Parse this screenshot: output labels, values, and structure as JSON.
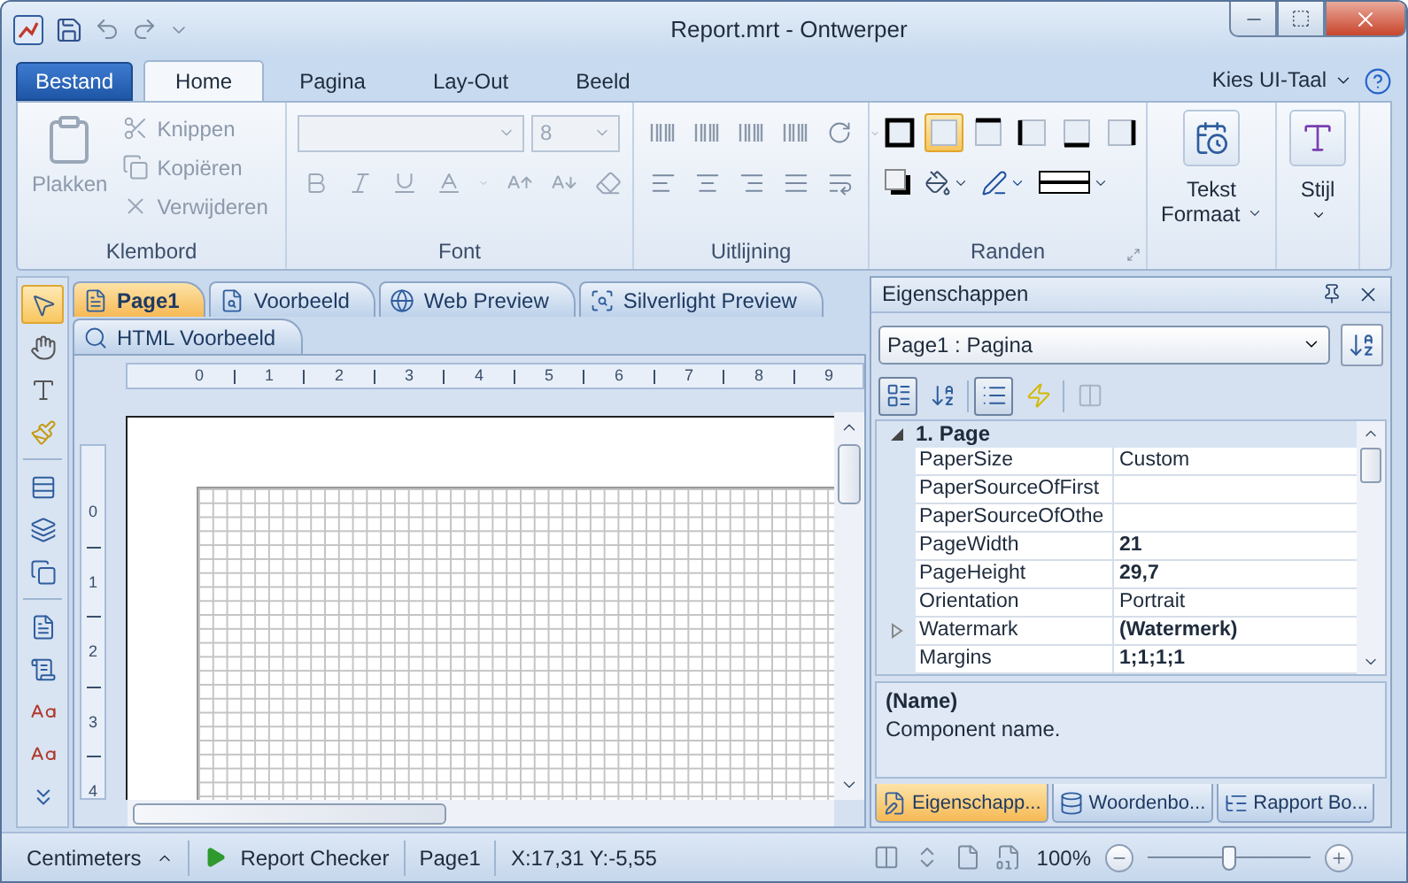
{
  "window": {
    "title": "Report.mrt - Ontwerper"
  },
  "ribbon_tabs": [
    {
      "label": "Bestand",
      "kind": "file",
      "selected": false
    },
    {
      "label": "Home",
      "kind": "tab",
      "selected": true
    },
    {
      "label": "Pagina",
      "kind": "tab",
      "selected": false
    },
    {
      "label": "Lay-Out",
      "kind": "tab",
      "selected": false
    },
    {
      "label": "Beeld",
      "kind": "tab",
      "selected": false
    }
  ],
  "language_menu": {
    "label": "Kies UI-Taal"
  },
  "clipboard": {
    "label": "Klembord",
    "paste": "Plakken",
    "disabled": true,
    "items": [
      {
        "label": "Knippen",
        "kind": "cut"
      },
      {
        "label": "Kopiëren",
        "kind": "copy"
      },
      {
        "label": "Verwijderen",
        "kind": "delete"
      }
    ]
  },
  "font": {
    "label": "Font",
    "size": "8",
    "disabled": true
  },
  "alignment": {
    "label": "Uitlijning"
  },
  "borders": {
    "label": "Randen",
    "buttons": [
      {
        "kind": "all",
        "selected": false
      },
      {
        "kind": "none",
        "selected": true
      },
      {
        "kind": "top",
        "selected": false
      },
      {
        "kind": "left",
        "selected": false
      },
      {
        "kind": "bottom",
        "selected": false
      },
      {
        "kind": "right",
        "selected": false
      }
    ]
  },
  "text_format": {
    "label": "Tekst Formaat"
  },
  "style": {
    "label": "Stijl"
  },
  "tools": [
    {
      "kind": "pointer",
      "selected": true
    },
    {
      "kind": "hand",
      "selected": false
    },
    {
      "kind": "text",
      "selected": false
    },
    {
      "kind": "brush",
      "selected": false
    },
    {
      "kind": "band",
      "selected": false
    },
    {
      "kind": "cross_band",
      "selected": false
    },
    {
      "kind": "container",
      "selected": false
    },
    {
      "kind": "page",
      "selected": false
    },
    {
      "kind": "list",
      "selected": false
    },
    {
      "kind": "text_field",
      "selected": false
    },
    {
      "kind": "rich_text",
      "selected": false
    },
    {
      "kind": "more",
      "selected": false
    }
  ],
  "document_tabs": [
    {
      "label": "Page1",
      "kind": "page",
      "selected": true
    },
    {
      "label": "Voorbeeld",
      "kind": "preview",
      "selected": false
    },
    {
      "label": "Web Preview",
      "kind": "web",
      "selected": false
    },
    {
      "label": "Silverlight Preview",
      "kind": "silverlight",
      "selected": false
    }
  ],
  "document_tabs_second_row": [
    {
      "label": "HTML Voorbeeld",
      "kind": "html",
      "selected": false
    }
  ],
  "ruler_horizontal": [
    "0",
    "1",
    "2",
    "3",
    "4",
    "5",
    "6",
    "7",
    "8",
    "9"
  ],
  "ruler_vertical": [
    "0",
    "1",
    "2",
    "3",
    "4"
  ],
  "properties": {
    "title": "Eigenschappen",
    "object": "Page1 : Pagina",
    "tools": [
      {
        "kind": "categorized",
        "selected": true
      },
      {
        "kind": "alphabetical",
        "selected": false
      },
      {
        "kind": "properties",
        "selected": true
      },
      {
        "kind": "events",
        "selected": false
      },
      {
        "kind": "pages",
        "selected": false
      }
    ],
    "category": {
      "label": "1. Page",
      "expanded": true
    },
    "rows": [
      {
        "name": "PaperSize",
        "value": "Custom",
        "bold": false,
        "expandable": false
      },
      {
        "name": "PaperSourceOfFirst",
        "bold": false,
        "expandable": false
      },
      {
        "name": "PaperSourceOfOthe",
        "bold": false,
        "expandable": false
      },
      {
        "name": "PageWidth",
        "value": "21",
        "bold": true,
        "expandable": false
      },
      {
        "name": "PageHeight",
        "value": "29,7",
        "bold": true,
        "expandable": false
      },
      {
        "name": "Orientation",
        "value": "Portrait",
        "bold": false,
        "expandable": false
      },
      {
        "name": "Watermark",
        "value": "(Watermerk)",
        "bold": true,
        "expandable": true
      },
      {
        "name": "Margins",
        "value": "1;1;1;1",
        "bold": true,
        "expandable": false
      }
    ],
    "description": {
      "title": "(Name)",
      "text": "Component name."
    },
    "panel_tabs": [
      {
        "label": "Eigenschapp...",
        "kind": "properties",
        "selected": true
      },
      {
        "label": "Woordenbo...",
        "kind": "dictionary",
        "selected": false
      },
      {
        "label": "Rapport Bo...",
        "kind": "tree",
        "selected": false
      }
    ]
  },
  "status_bar": {
    "units": "Centimeters",
    "checker": "Report Checker",
    "page": "Page1",
    "position": "X:17,31 Y:-5,55",
    "zoom": "100%",
    "zoom_slider": {
      "level": 0.5
    }
  }
}
